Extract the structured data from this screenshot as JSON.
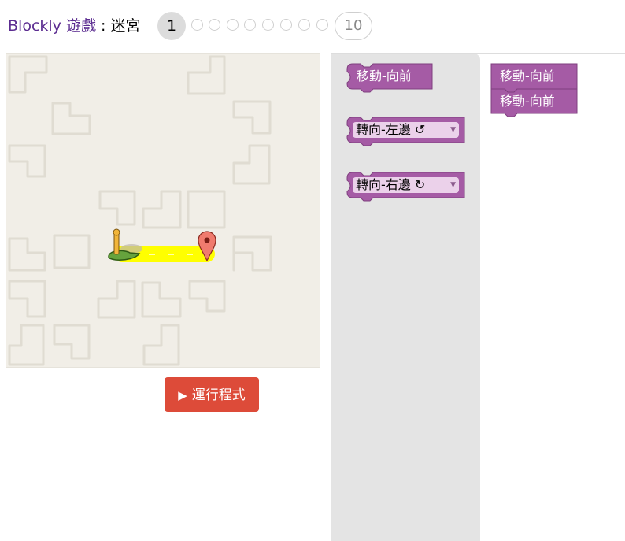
{
  "header": {
    "app_name": "Blockly",
    "game_link": "遊戲",
    "separator": " : ",
    "game_name": "迷宮",
    "current_level": "1",
    "last_level": "10"
  },
  "run_button": {
    "label": "運行程式",
    "icon": "play-icon"
  },
  "toolbox": {
    "move_forward": "移動-向前",
    "turn_left": "轉向-左邊 ↺",
    "turn_right": "轉向-右邊 ↻"
  },
  "workspace": {
    "blocks": [
      "移動-向前",
      "移動-向前"
    ]
  },
  "colors": {
    "block": "#a55ba5",
    "block_dark": "#7f3f7f",
    "run_button": "#dd4b39",
    "path": "#ffff00",
    "maze_bg": "#f1eee7",
    "flyout_bg": "#e4e4e4",
    "title_link": "#5c2d91"
  }
}
